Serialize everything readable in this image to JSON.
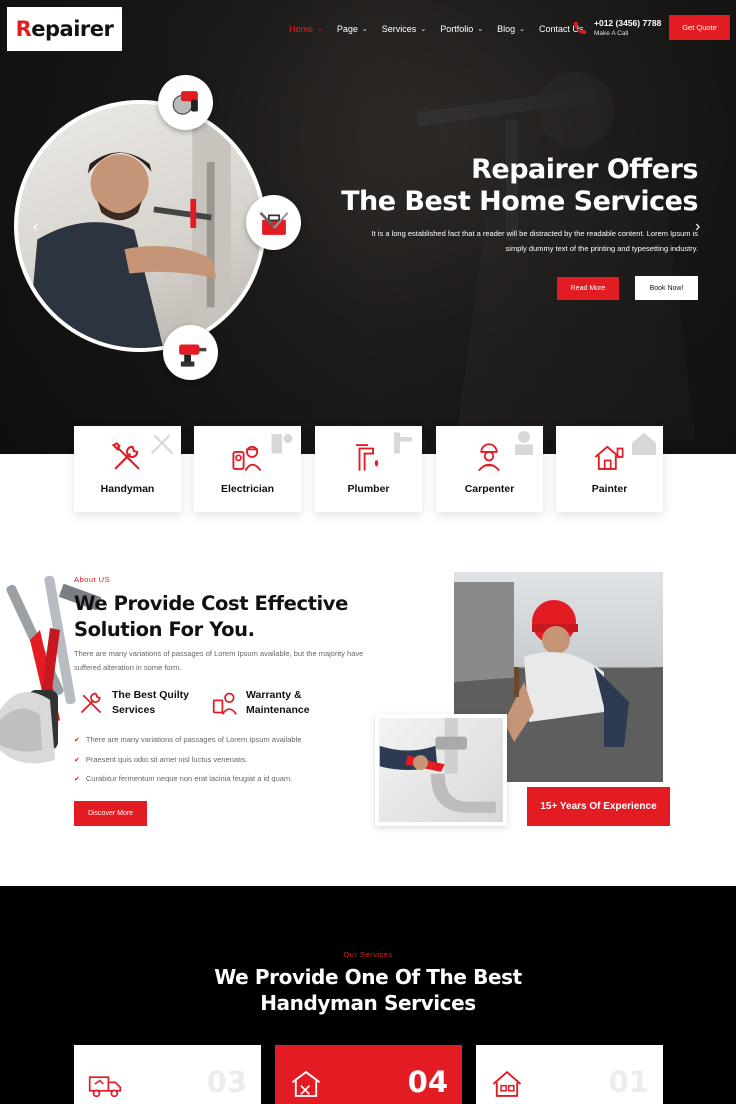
{
  "brand": {
    "logo_first": "R",
    "logo_rest": "epairer",
    "accent": "#e31b23"
  },
  "nav": {
    "items": [
      {
        "label": "Home",
        "active": true,
        "dropdown": true
      },
      {
        "label": "Page",
        "active": false,
        "dropdown": true
      },
      {
        "label": "Services",
        "active": false,
        "dropdown": true
      },
      {
        "label": "Portfolio",
        "active": false,
        "dropdown": true
      },
      {
        "label": "Blog",
        "active": false,
        "dropdown": true
      },
      {
        "label": "Contact Us",
        "active": false,
        "dropdown": false
      }
    ],
    "phone_number": "+012 (3456) 7788",
    "phone_label": "Make A Call",
    "quote_button": "Get Quote"
  },
  "hero": {
    "title_line1": "Repairer Offers",
    "title_line2": "The Best Home Services",
    "description": "It is a long established fact that a reader will be distracted by the readable content. Lorem Ipsum is simply dummy text of the printing and typesetting industry.",
    "primary_button": "Read More",
    "secondary_button": "Book Now!",
    "prev_arrow": "‹",
    "next_arrow": "›"
  },
  "services_strip": [
    {
      "label": "Handyman",
      "icon": "wrench-screwdriver-icon"
    },
    {
      "label": "Electrician",
      "icon": "electrician-icon"
    },
    {
      "label": "Plumber",
      "icon": "faucet-icon"
    },
    {
      "label": "Carpenter",
      "icon": "worker-icon"
    },
    {
      "label": "Painter",
      "icon": "house-paint-icon"
    }
  ],
  "about": {
    "eyebrow": "About US",
    "title_line1": "We Provide Cost Effective",
    "title_line2": "Solution For You.",
    "text": "There are many variations of passages of Lorem Ipsum available, but the majority have suffered alteration in some form.",
    "features": [
      {
        "line1": "The Best Quilty",
        "line2": "Services",
        "icon": "quality-tools-icon"
      },
      {
        "line1": "Warranty &",
        "line2": "Maintenance",
        "icon": "warranty-icon"
      }
    ],
    "bullets": [
      "There are many variations of passages of Lorem Ipsum available",
      "Praesent quis odio sit amet nisl luctus venenatis.",
      "Curabitur fermentum neque non erat lacinia feugiat a id quam."
    ],
    "button": "Discover More",
    "experience_badge": "15+ Years Of Experience"
  },
  "services_section": {
    "eyebrow": "Our Services",
    "title_line1": "We Provide One Of The Best",
    "title_line2": "Handyman Services",
    "cards": [
      {
        "number": "03",
        "icon": "delivery-truck-icon",
        "highlighted": false
      },
      {
        "number": "04",
        "icon": "house-tools-icon",
        "highlighted": true
      },
      {
        "number": "01",
        "icon": "house-repair-icon",
        "highlighted": false
      }
    ]
  }
}
